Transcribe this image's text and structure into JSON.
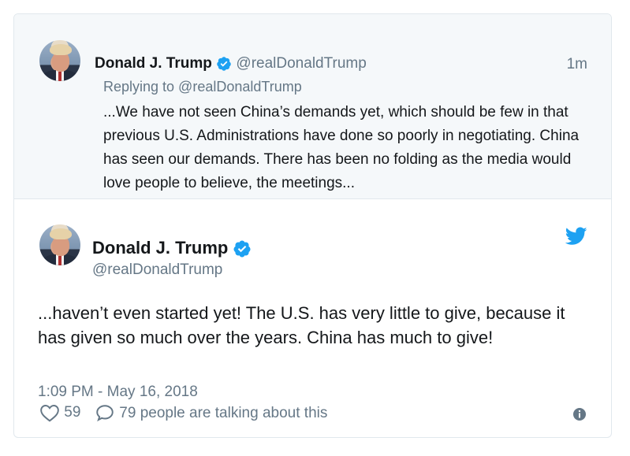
{
  "reply_tweet": {
    "name": "Donald J. Trump",
    "handle": "@realDonaldTrump",
    "time": "1m",
    "replying_to": "Replying to @realDonaldTrump",
    "text": "...We have not seen China’s demands yet, which should be few in that previous U.S. Administrations have done so poorly in negotiating. China has seen our demands. There has been no folding as the media would love people to believe, the meetings..."
  },
  "main_tweet": {
    "name": "Donald J. Trump",
    "handle": "@realDonaldTrump",
    "text": "...haven’t even started yet! The U.S. has very little to give, because it has given so much over the years. China has much to give!",
    "timestamp": "1:09 PM - May 16, 2018",
    "likes": "59",
    "talking": "79 people are talking about this"
  },
  "icons": {
    "verified": "verified-badge-icon",
    "twitter_bird": "twitter-bird-icon",
    "like": "heart-icon",
    "reply": "speech-bubble-icon",
    "info": "info-icon"
  },
  "colors": {
    "twitter_blue": "#1da1f2",
    "secondary_text": "#657786",
    "reply_background": "#f5f8fa"
  }
}
